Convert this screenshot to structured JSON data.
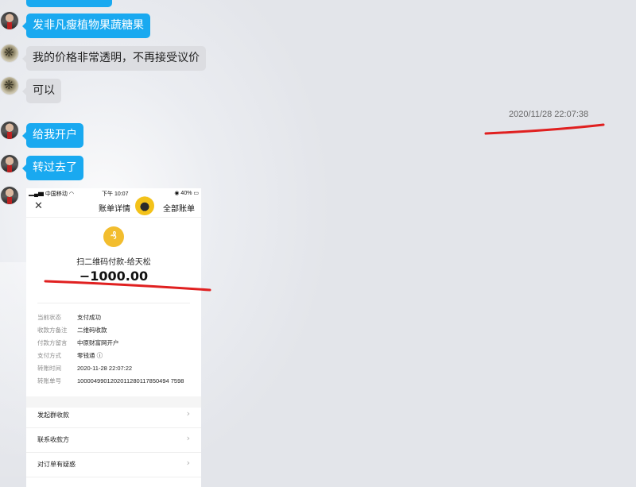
{
  "chat": {
    "timestamp": "2020/11/28 22:07:38",
    "messages": [
      {
        "sender": "customer",
        "text": "发非凡瘦植物果蔬糖果"
      },
      {
        "sender": "seller",
        "text": "我的价格非常透明，不再接受议价"
      },
      {
        "sender": "seller",
        "text": "可以"
      },
      {
        "sender": "customer",
        "text": "给我开户"
      },
      {
        "sender": "customer",
        "text": "转过去了"
      }
    ]
  },
  "receipt": {
    "status_bar": {
      "carrier": "中国移动",
      "time": "下午 10:07",
      "battery": "40%"
    },
    "nav": {
      "close": "✕",
      "title": "账单详情",
      "all_bills": "全部账单"
    },
    "payee": "扫二维码付款-给天松",
    "amount": "−1000.00",
    "details": [
      {
        "label": "当前状态",
        "value": "支付成功"
      },
      {
        "label": "收款方备注",
        "value": "二维码收款"
      },
      {
        "label": "付款方留言",
        "value": "中原财富网开户"
      },
      {
        "label": "支付方式",
        "value": "零钱通 ⓘ"
      },
      {
        "label": "转账时间",
        "value": "2020-11-28 22:07:22"
      },
      {
        "label": "转账单号",
        "value": "1000049901202011280117850494 7598"
      }
    ],
    "menu": [
      {
        "label": "发起群收款"
      },
      {
        "label": "联系收款方"
      },
      {
        "label": "对订单有疑惑"
      }
    ]
  },
  "colors": {
    "bubble_blue": "#19a9f0",
    "bubble_gray": "#dcdde1",
    "red_mark": "#e02020"
  }
}
